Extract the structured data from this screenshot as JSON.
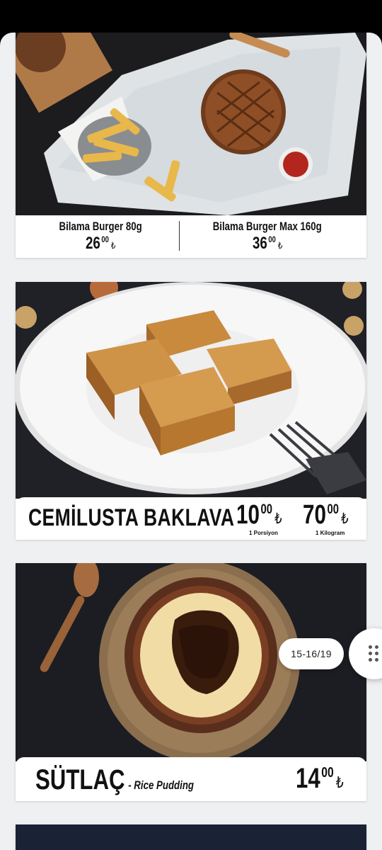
{
  "burger_card": {
    "items": [
      {
        "name": "Bilama Burger 80g",
        "price_whole": "26",
        "price_decimals": "00",
        "currency": "₺"
      },
      {
        "name": "Bilama Burger Max 160g",
        "price_whole": "36",
        "price_decimals": "00",
        "currency": "₺"
      }
    ]
  },
  "baklava_card": {
    "title": "CEMİLUSTA BAKLAVA",
    "prices": [
      {
        "whole": "10",
        "decimals": "00",
        "currency": "₺",
        "caption": "1 Porsiyon"
      },
      {
        "whole": "70",
        "decimals": "00",
        "currency": "₺",
        "caption": "1 Kilogram"
      }
    ]
  },
  "sutlac_card": {
    "title": "SÜTLAÇ",
    "subtitle": "- Rice Pudding",
    "price_whole": "14",
    "price_decimals": "00",
    "currency": "₺"
  },
  "pager": {
    "label": "15-16/19"
  },
  "colors": {
    "sheet": "#eef0f2",
    "top_bar": "#000000",
    "text": "#111111"
  }
}
